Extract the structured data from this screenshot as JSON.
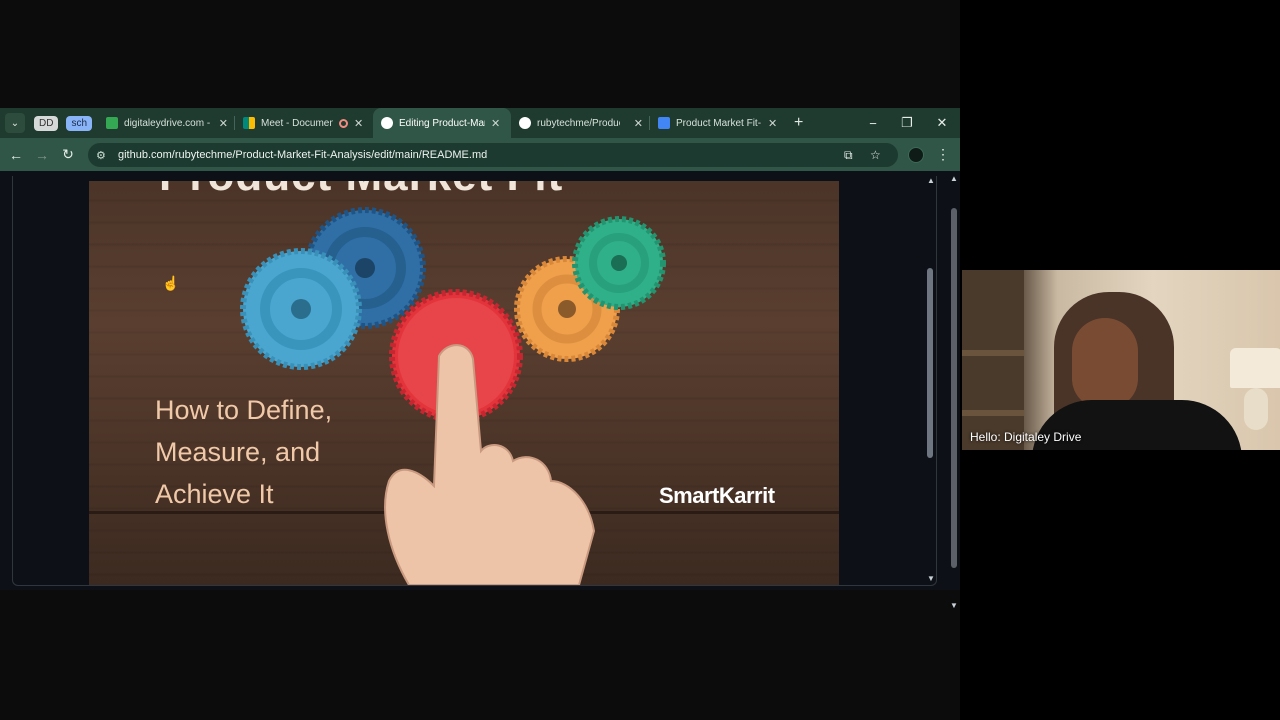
{
  "browser": {
    "tabs": [
      {
        "title": "digitaleydrive.com - C",
        "favicon_color": "#34a853",
        "active": false
      },
      {
        "title": "Meet - Document",
        "favicon_color": "#00897b",
        "active": false,
        "recording": true
      },
      {
        "title": "Editing Product-Mark",
        "favicon_color": "#ffffff",
        "active": true
      },
      {
        "title": "rubytechme/Product",
        "favicon_color": "#ffffff",
        "active": false
      },
      {
        "title": "Product Market Fit- K",
        "favicon_color": "#4285f4",
        "active": false
      }
    ],
    "tab_groups": [
      "DD",
      "sch"
    ],
    "close_glyph": "✕",
    "new_tab_glyph": "+",
    "url": "github.com/rubytechme/Product-Market-Fit-Analysis/edit/main/README.md",
    "accent_color": "#2f5646"
  },
  "readme_image": {
    "hidden_title": "Product Market Fit",
    "heading_lines": [
      "How to Define,",
      "Measure, and",
      "Achieve It"
    ],
    "brand": "SmartKarrit"
  },
  "webcam": {
    "caption": "Hello: Digitaley Drive"
  },
  "icons": {
    "tab_list": "chevron-down-icon",
    "back": "arrow-left-icon",
    "forward": "arrow-right-icon",
    "reload": "reload-icon",
    "site_info": "tune-icon",
    "install": "install-app-icon",
    "bookmark": "star-icon",
    "menu": "kebab-menu-icon",
    "minimize": "minimize-icon",
    "restore": "restore-icon",
    "close": "close-icon",
    "cursor": "hand-cursor-icon"
  }
}
